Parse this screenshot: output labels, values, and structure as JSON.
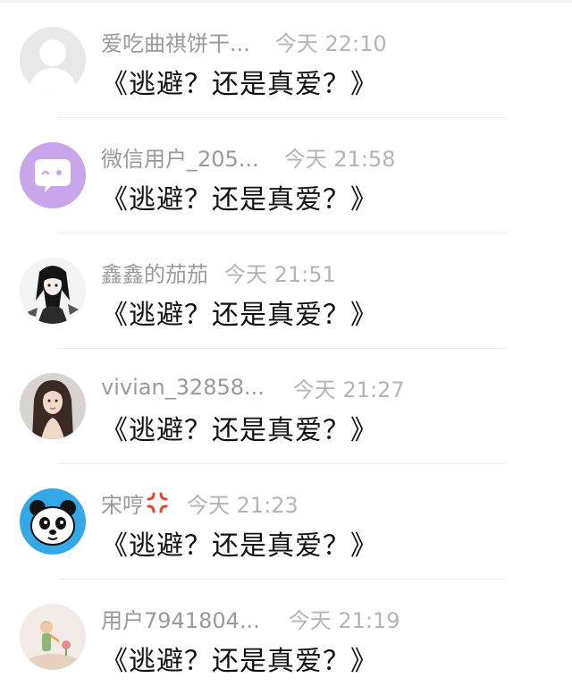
{
  "comments": [
    {
      "username": "爱吃曲祺饼干...",
      "time": "今天 22:10",
      "message": "《逃避？还是真爱？》",
      "avatar_icon": "default-user-avatar-icon"
    },
    {
      "username": "微信用户_205...",
      "time": "今天 21:58",
      "message": "《逃避？还是真爱？》",
      "avatar_icon": "chat-bubble-avatar-icon"
    },
    {
      "username": "鑫鑫的茄茄",
      "time": "今天 21:51",
      "message": "《逃避？还是真爱？》",
      "avatar_icon": "anime-girl-avatar-icon"
    },
    {
      "username": "vivian_32858...",
      "time": "今天 21:27",
      "message": "《逃避？还是真爱？》",
      "avatar_icon": "photo-woman-avatar-icon"
    },
    {
      "username": "宋哼",
      "time": "今天 21:23",
      "message": "《逃避？还是真爱？》",
      "avatar_icon": "panda-avatar-icon",
      "name_emoji": "anger-symbol-icon"
    },
    {
      "username": "用户7941804...",
      "time": "今天 21:19",
      "message": "《逃避？还是真爱？》",
      "avatar_icon": "little-prince-avatar-icon"
    }
  ],
  "colors": {
    "username": "#9a9a9a",
    "time": "#b5b5b5",
    "message": "#111111",
    "divider": "#eeeeee",
    "chat_avatar_bg": "#c9a6ea",
    "panda_avatar_bg": "#35a8e8",
    "anger_emoji": "#e8452c"
  }
}
